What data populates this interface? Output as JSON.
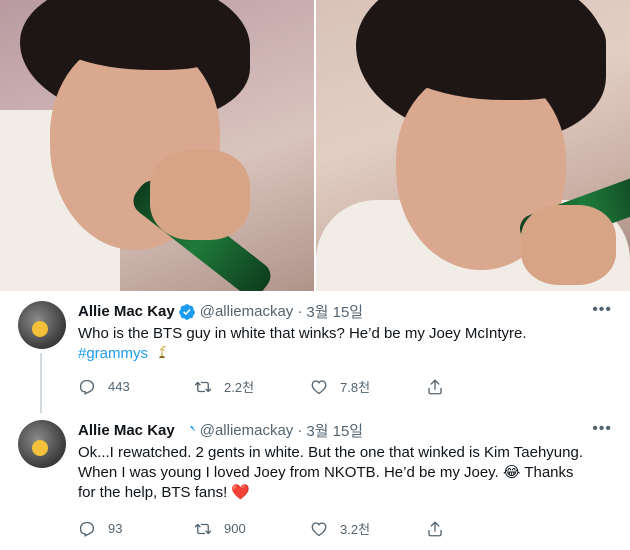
{
  "media": {
    "left_image": "photo",
    "right_image": "photo"
  },
  "tweets": [
    {
      "display_name": "Allie Mac Kay",
      "handle": "@alliemackay",
      "date": "3월 15일",
      "text_plain": "Who is the BTS guy in white that winks? He’d be my Joey McIntyre.",
      "hashtag": "#grammys",
      "replies": "443",
      "retweets": "2.2천",
      "likes": "7.8천"
    },
    {
      "display_name": "Allie Mac Kay",
      "handle": "@alliemackay",
      "date": "3월 15일",
      "text_line1": "Ok...I rewatched. 2 gents in white. But the one that winked is Kim Taehyung.",
      "text_line2": "When I was young I loved Joey from NKOTB. He’d be my Joey.",
      "emoji_laugh": "😂",
      "text_line2b": " Thanks",
      "text_line3": "for the help, BTS fans!",
      "emoji_heart": "❤️",
      "replies": "93",
      "retweets": "900",
      "likes": "3.2천"
    }
  ],
  "icons": {
    "verified_color": "#1d9bf0",
    "more": "more-icon",
    "reply": "reply-icon",
    "retweet": "retweet-icon",
    "like": "like-icon",
    "share": "share-icon",
    "grammy": "grammy-icon"
  },
  "ui": {
    "more_glyph": "•••",
    "separator": "·"
  }
}
